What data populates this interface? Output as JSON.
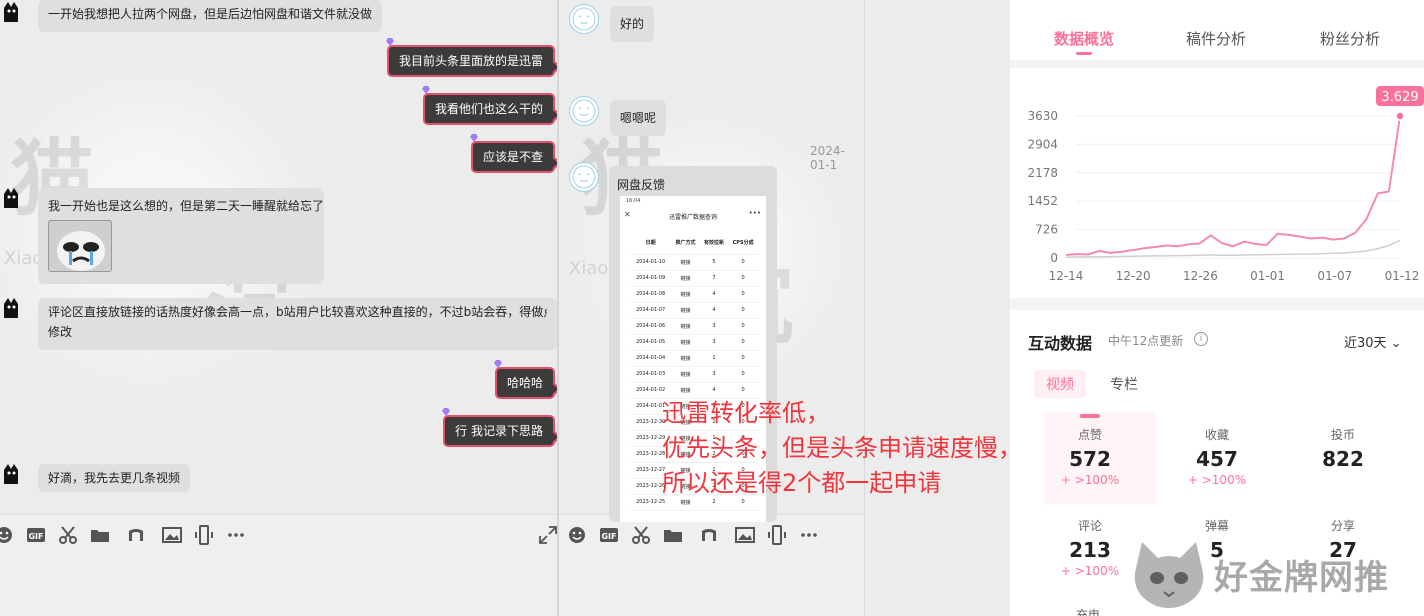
{
  "chat_left": {
    "messages": [
      {
        "side": "other",
        "text": "一开始我想把人拉两个网盘，但是后边怕网盘和谐文件就没做"
      },
      {
        "side": "self",
        "text": "我目前头条里面放的是迅雷"
      },
      {
        "side": "self",
        "text": "我看他们也这么干的"
      },
      {
        "side": "self",
        "text": "应该是不查"
      },
      {
        "side": "other",
        "text": "我一开始也是这么想的，但是第二天一睡醒就给忘了"
      },
      {
        "side": "other",
        "text": "评论区直接放链接的话热度好像会高一点，b站用户比较喜欢这种直接的，不过b站会吞，得做点"
      },
      {
        "side": "other",
        "text": "修改"
      },
      {
        "side": "self",
        "text": "哈哈哈"
      },
      {
        "side": "self",
        "text": "行  我记录下思路"
      },
      {
        "side": "other",
        "text": "好滴，我先去更几条视频"
      }
    ],
    "toolbar_icons": [
      "emoji-icon",
      "gif-icon",
      "scissors-icon",
      "folder-icon",
      "music-icon",
      "image-icon",
      "phone-icon",
      "more-icon",
      "expand-icon"
    ]
  },
  "chat_mid": {
    "messages": [
      {
        "side": "other",
        "text": "好的"
      },
      {
        "side": "other",
        "text": "嗯嗯呢"
      },
      {
        "side": "other",
        "text": "网盘反馈"
      }
    ],
    "date_label": "2024-01-1",
    "phone_screenshot": {
      "status": "16:04",
      "title": "迅雷推广数据查询",
      "headers": [
        "日期",
        "推广方式",
        "有效拉新",
        "CPS分成"
      ],
      "rows": [
        [
          "2024-01-10",
          "链接",
          "5",
          "0"
        ],
        [
          "2024-01-09",
          "链接",
          "7",
          "0"
        ],
        [
          "2024-01-08",
          "链接",
          "4",
          "0"
        ],
        [
          "2024-01-07",
          "链接",
          "4",
          "0"
        ],
        [
          "2024-01-06",
          "链接",
          "3",
          "0"
        ],
        [
          "2024-01-05",
          "链接",
          "3",
          "0"
        ],
        [
          "2024-01-04",
          "链接",
          "1",
          "0"
        ],
        [
          "2024-01-03",
          "链接",
          "3",
          "0"
        ],
        [
          "2024-01-02",
          "链接",
          "4",
          "0"
        ],
        [
          "2024-01-01",
          "链接",
          "1",
          "0"
        ],
        [
          "2023-12-30",
          "链接",
          "1",
          "0"
        ],
        [
          "2023-12-29",
          "链接",
          "1",
          "0"
        ],
        [
          "2023-12-28",
          "链接",
          "2",
          "0"
        ],
        [
          "2023-12-27",
          "链接",
          "1",
          "0"
        ],
        [
          "2023-12-26",
          "链接",
          "2",
          "0"
        ],
        [
          "2023-12-25",
          "链接",
          "2",
          "0"
        ]
      ]
    }
  },
  "annotation": {
    "lines": [
      "迅雷转化率低，",
      "优先头条，但是头条申请速度慢，",
      "所以还是得2个都一起申请"
    ]
  },
  "dashboard": {
    "tabs": [
      "数据概览",
      "稿件分析",
      "粉丝分析"
    ],
    "section_title": "互动数据",
    "section_sub": "中午12点更新",
    "info_glyph": "i",
    "range_label": "近30天",
    "sub_tabs": [
      "视频",
      "专栏"
    ],
    "metrics": [
      {
        "label": "点赞",
        "value": "572",
        "change": "+ >100%"
      },
      {
        "label": "收藏",
        "value": "457",
        "change": "+ >100%"
      },
      {
        "label": "投币",
        "value": "822",
        "change": ""
      },
      {
        "label": "评论",
        "value": "213",
        "change": "+ >100%"
      },
      {
        "label": "弹幕",
        "value": "5",
        "change": ""
      },
      {
        "label": "分享",
        "value": "27",
        "change": ""
      }
    ],
    "cutoff_label": "充电",
    "accent": "#fb7299"
  },
  "chart_data": {
    "type": "line",
    "x_ticks": [
      "12-14",
      "12-20",
      "12-26",
      "01-01",
      "01-07",
      "01-12"
    ],
    "y_ticks": [
      "0",
      "726",
      "1452",
      "2178",
      "2904",
      "3630"
    ],
    "ylim": [
      0,
      3630
    ],
    "peak_label": "3.629",
    "series": [
      {
        "values": [
          80,
          100,
          90,
          180,
          130,
          160,
          200,
          250,
          280,
          320,
          300,
          350,
          370,
          580,
          380,
          300,
          420,
          360,
          330,
          620,
          590,
          550,
          500,
          520,
          470,
          500,
          650,
          1000,
          1650,
          1700,
          3629
        ]
      },
      {
        "values": [
          20,
          25,
          30,
          30,
          35,
          40,
          45,
          50,
          55,
          55,
          60,
          65,
          70,
          80,
          70,
          70,
          80,
          80,
          85,
          90,
          95,
          100,
          100,
          110,
          120,
          130,
          150,
          180,
          240,
          320,
          450
        ]
      }
    ]
  },
  "watermarks": {
    "brand": "好金牌网推",
    "chat_text": "Xiao"
  }
}
